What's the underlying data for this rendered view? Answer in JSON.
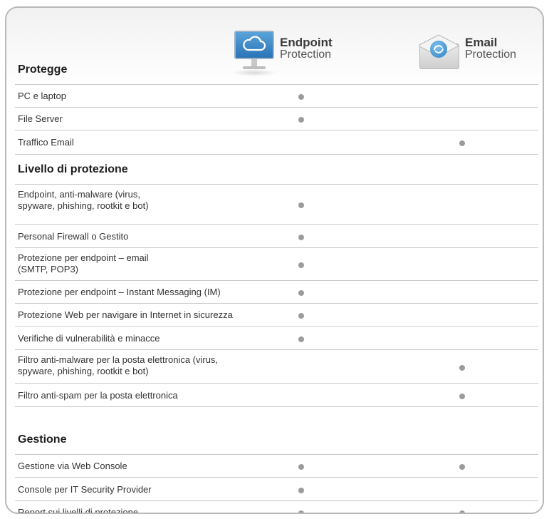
{
  "products": {
    "endpoint": {
      "name1": "Endpoint",
      "name2": "Protection",
      "icon": "monitor-cloud-icon"
    },
    "email": {
      "name1": "Email",
      "name2": "Protection",
      "icon": "envelope-icon"
    }
  },
  "sections": [
    {
      "title": "Protegge",
      "rows": [
        {
          "label": "PC e laptop",
          "endpoint": true,
          "email": false
        },
        {
          "label": "File Server",
          "endpoint": true,
          "email": false
        },
        {
          "label": "Traffico Email",
          "endpoint": false,
          "email": true
        }
      ]
    },
    {
      "title": "Livello di protezione",
      "rows": [
        {
          "label": "Endpoint, anti-malware (virus,\nspyware, phishing, rootkit e bot)",
          "endpoint": true,
          "email": false
        },
        {
          "label": "Personal Firewall o Gestito",
          "endpoint": true,
          "email": false
        },
        {
          "label": "Protezione per endpoint – email\n(SMTP, POP3)",
          "endpoint": true,
          "email": false
        },
        {
          "label": "Protezione per endpoint – Instant Messaging (IM)",
          "endpoint": true,
          "email": false
        },
        {
          "label": "Protezione Web per navigare in Internet in sicurezza",
          "endpoint": true,
          "email": false
        },
        {
          "label": "Verifiche di vulnerabilità e minacce",
          "endpoint": true,
          "email": false
        },
        {
          "label": "Filtro anti-malware per la posta elettronica (virus,\nspyware, phishing, rootkit e bot)",
          "endpoint": false,
          "email": true
        },
        {
          "label": "Filtro anti-spam per la posta elettronica",
          "endpoint": false,
          "email": true
        }
      ]
    },
    {
      "title": "Gestione",
      "rows": [
        {
          "label": "Gestione via Web Console",
          "endpoint": true,
          "email": true
        },
        {
          "label": "Console per IT Security Provider",
          "endpoint": true,
          "email": false
        },
        {
          "label": "Report sui livelli di protezione",
          "endpoint": true,
          "email": true
        }
      ]
    }
  ],
  "colors": {
    "dot": "#9b9b9b",
    "border": "#b9b9b9",
    "divider": "#c9c9c9"
  }
}
